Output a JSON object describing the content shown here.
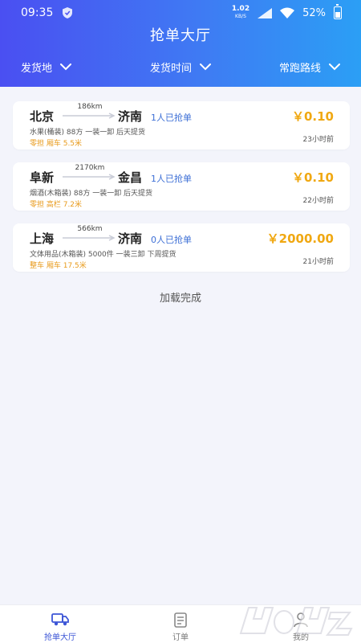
{
  "status_bar": {
    "time": "09:35",
    "net_speed_value": "1.02",
    "net_speed_unit": "KB/S",
    "battery": "52%"
  },
  "header": {
    "title": "抢单大厅",
    "filters": [
      {
        "label": "发货地"
      },
      {
        "label": "发货时间"
      },
      {
        "label": "常跑路线"
      }
    ]
  },
  "orders": [
    {
      "from": "北京",
      "to": "济南",
      "distance": "186km",
      "grabbed": "1人已抢单",
      "price": "￥0.10",
      "desc": "水果(桶装) 88方 一装一卸 后天提货",
      "tags": "零担 厢车 5.5米",
      "ago": "23小时前"
    },
    {
      "from": "阜新",
      "to": "金昌",
      "distance": "2170km",
      "grabbed": "1人已抢单",
      "price": "￥0.10",
      "desc": "烟酒(木箱装) 88方 一装一卸 后天提货",
      "tags": "零担 高栏 7.2米",
      "ago": "22小时前"
    },
    {
      "from": "上海",
      "to": "济南",
      "distance": "566km",
      "grabbed": "0人已抢单",
      "price": "￥2000.00",
      "desc": "文体用品(木箱装) 5000件 一装三卸 下周提货",
      "tags": "整车 厢车 17.5米",
      "ago": "21小时前"
    }
  ],
  "load_status": "加载完成",
  "tabbar": {
    "tabs": [
      {
        "label": "抢单大厅",
        "icon": "truck-icon"
      },
      {
        "label": "订单",
        "icon": "clipboard-icon"
      },
      {
        "label": "我的",
        "icon": "user-icon"
      }
    ]
  },
  "colors": {
    "header_gradient_start": "#4a4ff2",
    "header_gradient_end": "#2b9ff5",
    "price": "#f0a812",
    "tag": "#e89a1a",
    "grabbed": "#3d6fd6",
    "active_tab": "#3d56d6"
  }
}
